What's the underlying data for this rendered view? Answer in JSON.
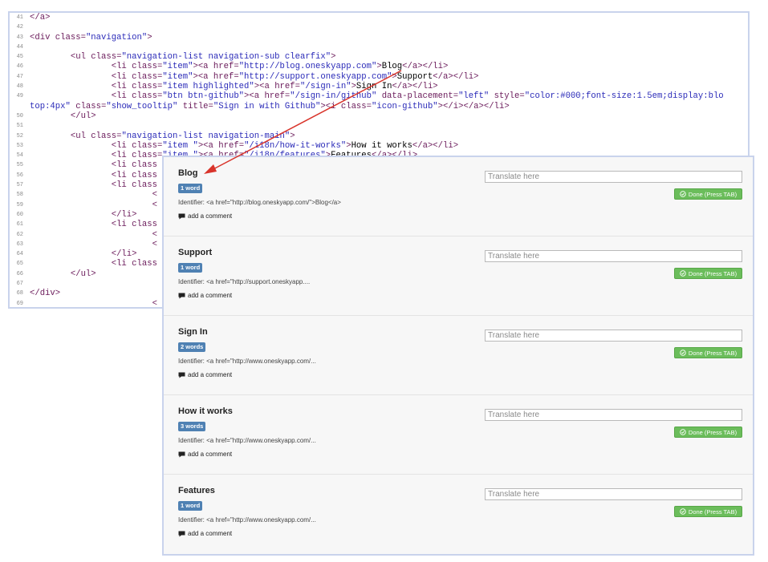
{
  "code": {
    "lines": [
      {
        "n": "41",
        "html": "<span class='t-tag'>&lt;/a&gt;</span>"
      },
      {
        "n": "42",
        "html": ""
      },
      {
        "n": "43",
        "html": "<span class='t-tag'>&lt;div</span> <span class='t-attr'>class=</span><span class='t-str'>\"navigation\"</span><span class='t-tag'>&gt;</span>"
      },
      {
        "n": "44",
        "html": ""
      },
      {
        "n": "45",
        "html": "        <span class='t-tag'>&lt;ul</span> <span class='t-attr'>class=</span><span class='t-str'>\"navigation-list navigation-sub clearfix\"</span><span class='t-tag'>&gt;</span>"
      },
      {
        "n": "46",
        "html": "                <span class='t-tag'>&lt;li</span> <span class='t-attr'>class=</span><span class='t-str'>\"item\"</span><span class='t-tag'>&gt;&lt;a</span> <span class='t-attr'>href=</span><span class='t-str'>\"http://blog.oneskyapp.com\"</span><span class='t-tag'>&gt;</span>Blog<span class='t-tag'>&lt;/a&gt;&lt;/li&gt;</span>"
      },
      {
        "n": "47",
        "html": "                <span class='t-tag'>&lt;li</span> <span class='t-attr'>class=</span><span class='t-str'>\"item\"</span><span class='t-tag'>&gt;&lt;a</span> <span class='t-attr'>href=</span><span class='t-str'>\"http://support.oneskyapp.com\"</span><span class='t-tag'>&gt;</span>Support<span class='t-tag'>&lt;/a&gt;&lt;/li&gt;</span>"
      },
      {
        "n": "48",
        "html": "                <span class='t-tag'>&lt;li</span> <span class='t-attr'>class=</span><span class='t-str'>\"item highlighted\"</span><span class='t-tag'>&gt;&lt;a</span> <span class='t-attr'>href=</span><span class='t-str'>\"/sign-in\"</span><span class='t-tag'>&gt;</span>Sign In<span class='t-tag'>&lt;/a&gt;&lt;/li&gt;</span>"
      },
      {
        "n": "49",
        "html": "                <span class='t-tag'>&lt;li</span> <span class='t-attr'>class=</span><span class='t-str'>\"btn btn-github\"</span><span class='t-tag'>&gt;&lt;a</span> <span class='t-attr'>href=</span><span class='t-str'>\"/sign-in/github\"</span> <span class='t-attr'>data-placement=</span><span class='t-str'>\"left\"</span> <span class='t-attr'>style=</span><span class='t-str'>\"color:#000;font-size:1.5em;display:blo</span>"
      },
      {
        "n": "",
        "html": "<span class='t-str'>top:4px\"</span> <span class='t-attr'>class=</span><span class='t-str'>\"show_tooltip\"</span> <span class='t-attr'>title=</span><span class='t-str'>\"Sign in with Github\"</span><span class='t-tag'>&gt;&lt;i</span> <span class='t-attr'>class=</span><span class='t-str'>\"icon-github\"</span><span class='t-tag'>&gt;&lt;/i&gt;&lt;/a&gt;&lt;/li&gt;</span>",
        "wrap": true
      },
      {
        "n": "50",
        "html": "        <span class='t-tag'>&lt;/ul&gt;</span>"
      },
      {
        "n": "51",
        "html": ""
      },
      {
        "n": "52",
        "html": "        <span class='t-tag'>&lt;ul</span> <span class='t-attr'>class=</span><span class='t-str'>\"navigation-list navigation-main\"</span><span class='t-tag'>&gt;</span>"
      },
      {
        "n": "53",
        "html": "                <span class='t-tag'>&lt;li</span> <span class='t-attr'>class=</span><span class='t-str'>\"item \"</span><span class='t-tag'>&gt;&lt;a</span> <span class='t-attr'>href=</span><span class='t-str'>\"/i18n/how-it-works\"</span><span class='t-tag'>&gt;</span>How it works<span class='t-tag'>&lt;/a&gt;&lt;/li&gt;</span>"
      },
      {
        "n": "54",
        "html": "                <span class='t-tag'>&lt;li</span> <span class='t-attr'>class=</span><span class='t-str'>\"item \"</span><span class='t-tag'>&gt;&lt;a</span> <span class='t-attr'>href=</span><span class='t-str'>\"/i18n/features\"</span><span class='t-tag'>&gt;</span>Features<span class='t-tag'>&lt;/a&gt;&lt;/li&gt;</span>"
      },
      {
        "n": "55",
        "html": "                <span class='t-tag'>&lt;li</span> <span class='t-attr'>class</span>"
      },
      {
        "n": "56",
        "html": "                <span class='t-tag'>&lt;li</span> <span class='t-attr'>class</span>"
      },
      {
        "n": "57",
        "html": "                <span class='t-tag'>&lt;li</span> <span class='t-attr'>class</span>"
      },
      {
        "n": "58",
        "html": "                        <span class='t-tag'>&lt;</span>"
      },
      {
        "n": "59",
        "html": "                        <span class='t-tag'>&lt;</span>"
      },
      {
        "n": "60",
        "html": "                <span class='t-tag'>&lt;/li&gt;</span>"
      },
      {
        "n": "61",
        "html": "                <span class='t-tag'>&lt;li</span> <span class='t-attr'>class</span>"
      },
      {
        "n": "62",
        "html": "                        <span class='t-tag'>&lt;</span>"
      },
      {
        "n": "63",
        "html": "                        <span class='t-tag'>&lt;</span>"
      },
      {
        "n": "64",
        "html": "                <span class='t-tag'>&lt;/li&gt;</span>"
      },
      {
        "n": "65",
        "html": "                <span class='t-tag'>&lt;li</span> <span class='t-attr'>class</span>"
      },
      {
        "n": "66",
        "html": "        <span class='t-tag'>&lt;/ul&gt;</span>"
      },
      {
        "n": "67",
        "html": ""
      },
      {
        "n": "68",
        "html": "<span class='t-tag'>&lt;/div&gt;</span>"
      },
      {
        "n": "69",
        "html": "                        <span class='t-tag'>&lt;</span>"
      }
    ]
  },
  "translation": {
    "input_placeholder": "Translate here",
    "done_label": "Done (Press TAB)",
    "comment_label": "add a comment",
    "items": [
      {
        "title": "Blog",
        "badge": "1 word",
        "identifier": "Identifier: <a href=\"http://blog.oneskyapp.com/\">Blog</a>"
      },
      {
        "title": "Support",
        "badge": "1 word",
        "identifier": "Identifier: <a href=\"http://support.oneskyapp...."
      },
      {
        "title": "Sign In",
        "badge": "2 words",
        "identifier": "Identifier: <a href=\"http://www.oneskyapp.com/..."
      },
      {
        "title": "How it works",
        "badge": "3 words",
        "identifier": "Identifier: <a href=\"http://www.oneskyapp.com/..."
      },
      {
        "title": "Features",
        "badge": "1 word",
        "identifier": "Identifier: <a href=\"http://www.oneskyapp.com/..."
      }
    ]
  },
  "colors": {
    "accent_badge": "#4f81b3",
    "done_button": "#6bbd5b",
    "arrow": "#d9342b"
  }
}
